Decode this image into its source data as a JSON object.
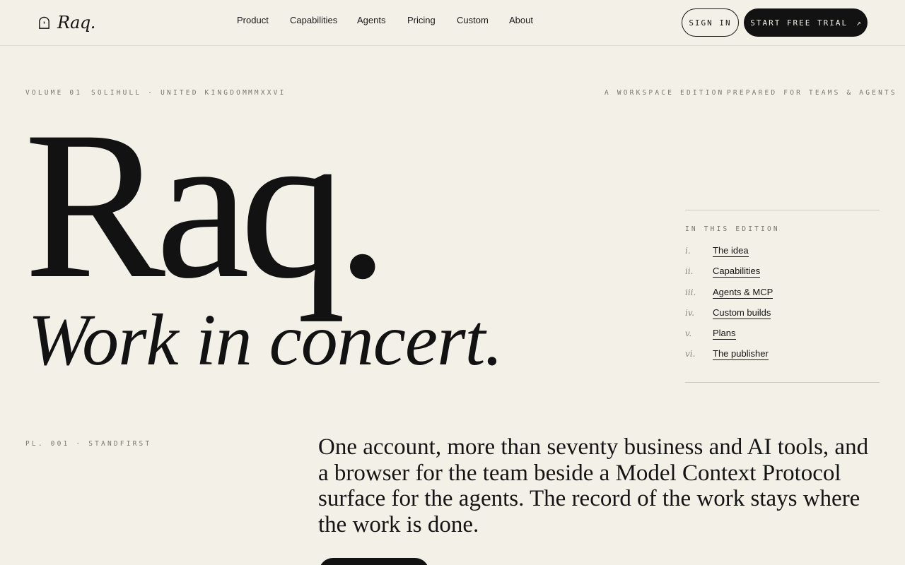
{
  "header": {
    "brand": "Raq.",
    "nav": [
      {
        "label": "Product"
      },
      {
        "label": "Capabilities"
      },
      {
        "label": "Agents"
      },
      {
        "label": "Pricing"
      },
      {
        "label": "Custom"
      },
      {
        "label": "About"
      }
    ],
    "sign_in": "SIGN IN",
    "start_trial": "START FREE TRIAL",
    "start_trial_icon": "arrow-up-right-icon"
  },
  "meta": {
    "volume": "VOLUME 01",
    "location": "SOLIHULL · UNITED KINGDOM",
    "year": "MMXXVI",
    "edition": "A WORKSPACE EDITION",
    "prepared": "PREPARED FOR TEAMS & AGENTS"
  },
  "hero": {
    "title": "Raq.",
    "subtitle": "Work in concert."
  },
  "toc": {
    "heading": "IN THIS EDITION",
    "items": [
      {
        "num": "i.",
        "label": "The idea"
      },
      {
        "num": "ii.",
        "label": "Capabilities"
      },
      {
        "num": "iii.",
        "label": "Agents & MCP"
      },
      {
        "num": "iv.",
        "label": "Custom builds"
      },
      {
        "num": "v.",
        "label": "Plans"
      },
      {
        "num": "vi.",
        "label": "The publisher"
      }
    ]
  },
  "standfirst": {
    "label": "PL. 001 · STANDFIRST",
    "text": "One account, more than seventy business and AI tools, and a browser for the team beside a Model Context Protocol surface for the agents. The record of the work stays where the work is done."
  },
  "colors": {
    "background": "#f3f0e8",
    "ink": "#141414",
    "muted": "#7a766d"
  }
}
